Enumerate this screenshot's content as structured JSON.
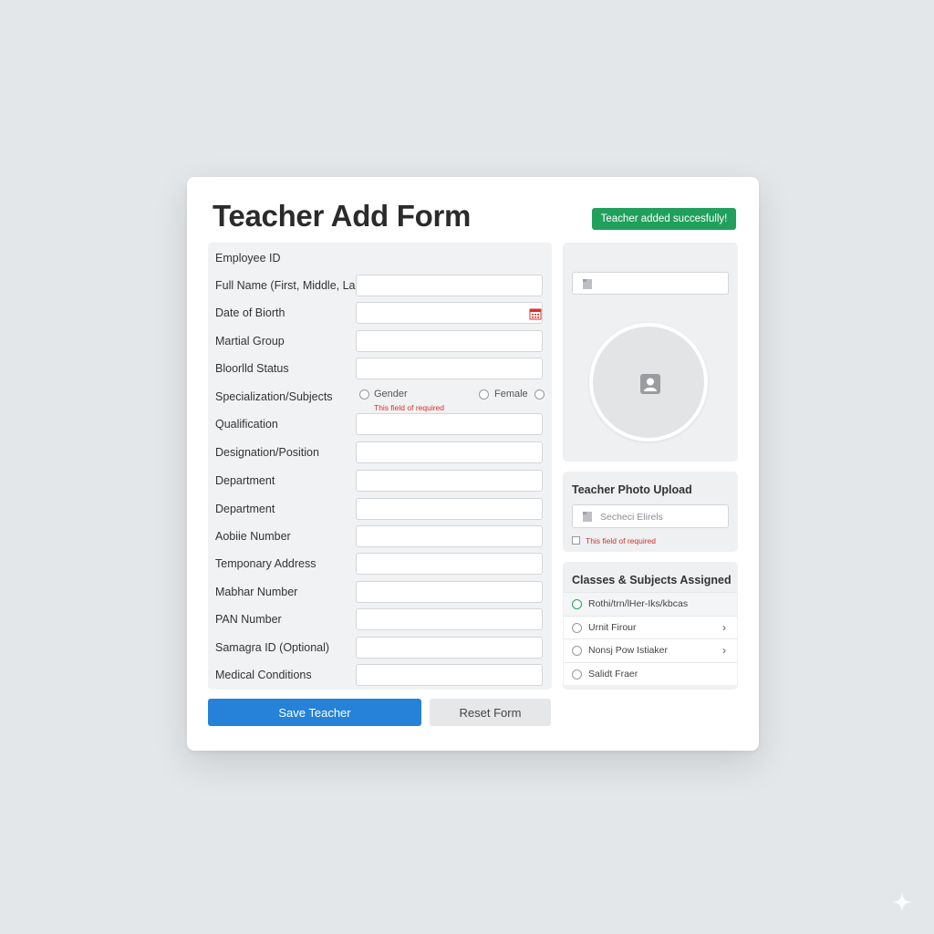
{
  "header": {
    "title": "Teacher Add Form",
    "toast": "Teacher added succesfully!"
  },
  "form": {
    "fields": [
      {
        "label": "Employee ID",
        "has_input": false
      },
      {
        "label": "Full Name (First, Middle, Last)",
        "has_input": true
      },
      {
        "label": "Date of Biorth",
        "has_input": true,
        "icon": "calendar-icon"
      },
      {
        "label": "Martial Group",
        "has_input": true
      },
      {
        "label": "Bloorlld Status",
        "has_input": true
      },
      {
        "label": "Specialization/Subjects",
        "type": "radio"
      },
      {
        "label": "Qualification",
        "has_input": true
      },
      {
        "label": "Designation/Position",
        "has_input": true
      },
      {
        "label": "Department",
        "has_input": true
      },
      {
        "label": "Department",
        "has_input": true
      },
      {
        "label": "Aobiie Number",
        "has_input": true
      },
      {
        "label": "Temponary Address",
        "has_input": true
      },
      {
        "label": "Mabhar Number",
        "has_input": true
      },
      {
        "label": "PAN Number",
        "has_input": true
      },
      {
        "label": "Samagra ID (Optional)",
        "has_input": true
      },
      {
        "label": "Medical Conditions",
        "has_input": true
      }
    ],
    "gender": {
      "option1": "Gender",
      "option2": "Female",
      "error": "This field of required"
    }
  },
  "buttons": {
    "save": "Save Teacher",
    "reset": "Reset Form"
  },
  "photo_upload": {
    "title": "Teacher Photo Upload",
    "placeholder": "Secheci Elirels",
    "error": "This field of required"
  },
  "classes": {
    "title": "Classes & Subjects Assigned",
    "items": [
      {
        "label": "Rothi/trn/lHer-Iks/kbcas",
        "selected": true,
        "chevron": false
      },
      {
        "label": "Urnit Firour",
        "selected": false,
        "chevron": true
      },
      {
        "label": "Nonsj Pow Istiaker",
        "selected": false,
        "chevron": true
      },
      {
        "label": "Salidt Fraer",
        "selected": false,
        "chevron": false
      }
    ]
  },
  "colors": {
    "accent": "#2582d8",
    "success": "#20a05c",
    "error": "#d9302c"
  }
}
